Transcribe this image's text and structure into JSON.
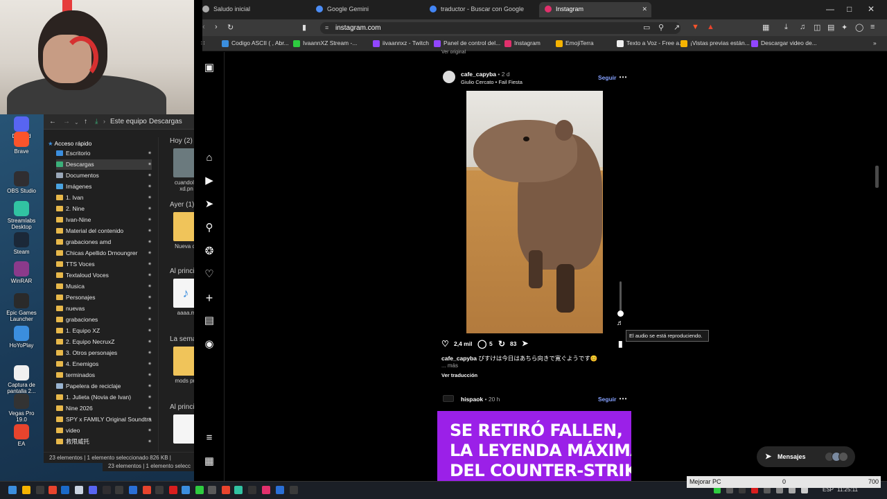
{
  "desktop": {
    "icons": [
      {
        "label": "Discord",
        "icon": "discord-icon",
        "color": "#5865f2"
      },
      {
        "label": "Brave",
        "icon": "brave-icon",
        "color": "#fb542b"
      },
      {
        "label": "OBS Studio",
        "icon": "obs-icon",
        "color": "#302e31"
      },
      {
        "label": "Streamlabs Desktop",
        "icon": "streamlabs-icon",
        "color": "#31c3a2"
      },
      {
        "label": "Steam",
        "icon": "steam-icon",
        "color": "#1b2838"
      },
      {
        "label": "WinRAR",
        "icon": "winrar-icon",
        "color": "#8b3a8b"
      },
      {
        "label": "Epic Games Launcher",
        "icon": "epic-icon",
        "color": "#2a2a2a"
      },
      {
        "label": "HoYoPlay",
        "icon": "hoyoplay-icon",
        "color": "#3b8ede"
      },
      {
        "label": "Captura de pantalla 2...",
        "icon": "screenshot-icon",
        "color": "#f0f0f0"
      },
      {
        "label": "Vegas Pro 19.0",
        "icon": "vegas-icon",
        "color": "#333333"
      },
      {
        "label": "EA",
        "icon": "ea-icon",
        "color": "#e8442d"
      }
    ]
  },
  "explorer": {
    "breadcrumb": [
      "Este equipo",
      "Descargas"
    ],
    "quick_access": "Acceso rápido",
    "tree": [
      {
        "label": "Escritorio",
        "color": "#3b8ede",
        "selected": false
      },
      {
        "label": "Descargas",
        "color": "#3bb07a",
        "selected": true
      },
      {
        "label": "Documentos",
        "color": "#9aa7b8",
        "selected": false
      },
      {
        "label": "Imágenes",
        "color": "#4aa3e0",
        "selected": false
      },
      {
        "label": "1. Ivan",
        "color": "#e8b84a",
        "selected": false
      },
      {
        "label": "2. Nine",
        "color": "#e8b84a",
        "selected": false
      },
      {
        "label": "Ivan-Nine",
        "color": "#e8b84a",
        "selected": false
      },
      {
        "label": "Material del contenido",
        "color": "#e8b84a",
        "selected": false
      },
      {
        "label": "grabaciones amd",
        "color": "#e8b84a",
        "selected": false
      },
      {
        "label": "Chicas Apellido Drnoungrer",
        "color": "#e8b84a",
        "selected": false
      },
      {
        "label": "TTS Voces",
        "color": "#e8b84a",
        "selected": false
      },
      {
        "label": "Textaloud Voces",
        "color": "#e8b84a",
        "selected": false
      },
      {
        "label": "Musica",
        "color": "#e8b84a",
        "selected": false
      },
      {
        "label": "Personajes",
        "color": "#e8b84a",
        "selected": false
      },
      {
        "label": "nuevas",
        "color": "#e8b84a",
        "selected": false
      },
      {
        "label": "grabaciones",
        "color": "#e8b84a",
        "selected": false
      },
      {
        "label": "1. Equipo XZ",
        "color": "#e8b84a",
        "selected": false
      },
      {
        "label": "2. Equipo NecruxZ",
        "color": "#e8b84a",
        "selected": false
      },
      {
        "label": "3. Otros personajes",
        "color": "#e8b84a",
        "selected": false
      },
      {
        "label": "4. Enemigos",
        "color": "#e8b84a",
        "selected": false
      },
      {
        "label": "terminados",
        "color": "#e8b84a",
        "selected": false
      },
      {
        "label": "Papelera de reciclaje",
        "color": "#9ab4d0",
        "selected": false
      },
      {
        "label": "1. Julieta (Novia de Ivan)",
        "color": "#e8b84a",
        "selected": false
      },
      {
        "label": "Nine 2026",
        "color": "#e8b84a",
        "selected": false
      },
      {
        "label": "SPY x FAMILY Original Soundtrack",
        "color": "#e8b84a",
        "selected": false
      },
      {
        "label": "video",
        "color": "#e8b84a",
        "selected": false
      },
      {
        "label": "救限威托",
        "color": "#e8b84a",
        "selected": false
      }
    ],
    "groups": [
      {
        "label": "Hoy (2)",
        "file": "cuandolle xd.pn",
        "kind": "img"
      },
      {
        "label": "Ayer (1)",
        "file": "Nueva ca",
        "kind": "folder"
      },
      {
        "label": "Al princi",
        "file": "aaaa.m",
        "kind": "music"
      },
      {
        "label": "La sema",
        "file": "mods pro",
        "kind": "folder"
      },
      {
        "label": "Al princi",
        "file": "",
        "kind": "doc"
      }
    ],
    "status": "23 elementos  |  1 elemento seleccionado  826 KB  |",
    "status2": "23 elementos  |  1 elemento selecc"
  },
  "browser": {
    "tabs": [
      {
        "label": "Saludo inicial",
        "active": false
      },
      {
        "label": "Google Gemini",
        "active": false
      },
      {
        "label": "traductor - Buscar con Google",
        "active": false
      },
      {
        "label": "Instagram",
        "active": true
      }
    ],
    "url": "instagram.com",
    "bookmarks": [
      {
        "label": "Codigo ASCII ( , Abr...",
        "color": "#3b8ede"
      },
      {
        "label": "IvaannXZ Stream -...",
        "color": "#2ecc40"
      },
      {
        "label": "iivaannxz - Twitch",
        "color": "#9146ff"
      },
      {
        "label": "Panel de control del...",
        "color": "#9146ff"
      },
      {
        "label": "Instagram",
        "color": "#e1306c"
      },
      {
        "label": "EmojiTerra",
        "color": "#f5b301"
      },
      {
        "label": "Texto a Voz - Free a...",
        "color": "#eeeeee"
      },
      {
        "label": "¡Vistas previas están...",
        "color": "#f5b301"
      },
      {
        "label": "Descargar video de...",
        "color": "#9146ff"
      }
    ]
  },
  "instagram": {
    "top_note": "Ver original",
    "post": {
      "username": "cafe_capyba",
      "time": "• 2 d",
      "audio": "Giulio Cercato • Fail Fiesta",
      "follow": "Seguir",
      "likes": "2,4 mil",
      "comments": "5",
      "reposts": "83",
      "caption_user": "cafe_capyba",
      "caption_text": "ぴすけは今日はあちら向きで寛ぐようです😊",
      "more": "... más",
      "translate": "Ver traducción",
      "tooltip": "El audio se está reproduciendo."
    },
    "post2": {
      "username": "hispaok",
      "time": "• 20 h",
      "follow": "Seguir",
      "banner_lines": [
        "SE RETIRÓ FALLEN,",
        "LA LEYENDA MÁXIMA",
        "DEL COUNTER-STRIKE"
      ]
    },
    "messages": "Mensajes"
  },
  "taskbar": {
    "lang": "ESP",
    "time": "11:25:11"
  },
  "popup": {
    "label": "Mejorar PC",
    "value1": "0",
    "value2": "700"
  }
}
